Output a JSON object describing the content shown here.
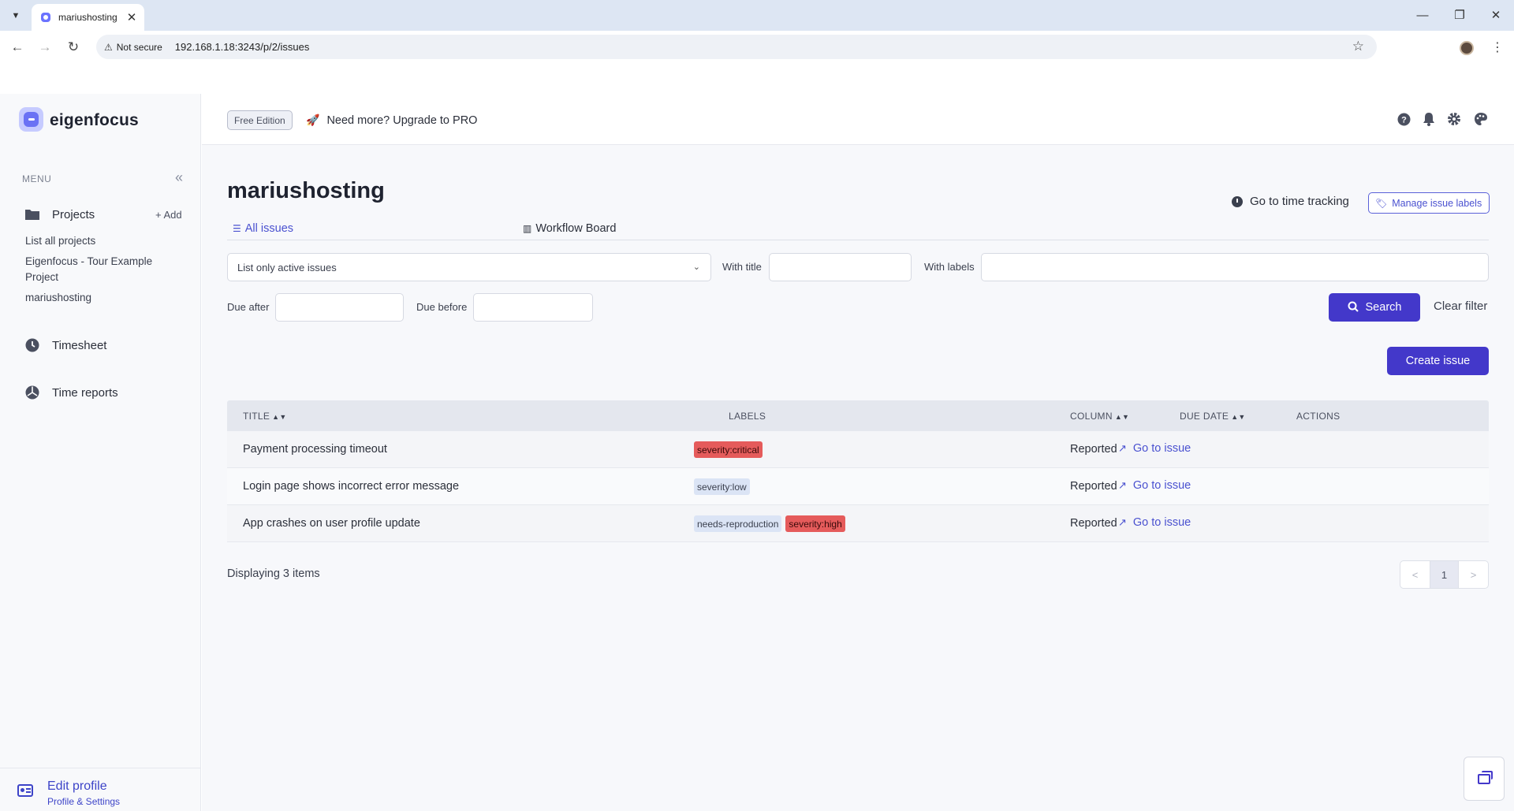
{
  "browser": {
    "tab_title": "mariushosting",
    "not_secure": "Not secure",
    "url": "192.168.1.18:3243/p/2/issues"
  },
  "sidebar": {
    "brand": "eigenfocus",
    "menu_label": "MENU",
    "projects_label": "Projects",
    "add_label": "Add",
    "project_links": [
      "List all projects",
      "Eigenfocus - Tour Example Project",
      "mariushosting"
    ],
    "timesheet_label": "Timesheet",
    "time_reports_label": "Time reports",
    "edit_profile": "Edit profile",
    "profile_settings": "Profile & Settings"
  },
  "topbar": {
    "edition_badge": "Free Edition",
    "upgrade_text": "Need more? Upgrade to PRO"
  },
  "page": {
    "title": "mariushosting",
    "time_tracking_link": "Go to time tracking",
    "manage_labels_button": "Manage issue labels",
    "tabs": {
      "all_issues": "All issues",
      "workflow_board": "Workflow Board"
    }
  },
  "filters": {
    "status_select": "List only active issues",
    "with_title_label": "With title",
    "with_title_value": "",
    "with_labels_label": "With labels",
    "with_labels_value": "",
    "due_after_label": "Due after",
    "due_after_value": "",
    "due_before_label": "Due before",
    "due_before_value": "",
    "search_button": "Search",
    "clear_filter": "Clear filter"
  },
  "create_issue_button": "Create issue",
  "table": {
    "headers": {
      "title": "TITLE",
      "labels": "LABELS",
      "column": "COLUMN",
      "due_date": "DUE DATE",
      "actions": "ACTIONS"
    },
    "rows": [
      {
        "title": "Payment processing timeout",
        "labels": [
          {
            "text": "severity:critical",
            "bg": "#e55b5b",
            "fg": "#3a0a0a"
          }
        ],
        "column": "Reported",
        "due_date": "",
        "action": "Go to issue"
      },
      {
        "title": "Login page shows incorrect error message",
        "labels": [
          {
            "text": "severity:low",
            "bg": "#dbe4f5",
            "fg": "#3a3f4d"
          }
        ],
        "column": "Reported",
        "due_date": "",
        "action": "Go to issue"
      },
      {
        "title": "App crashes on user profile update",
        "labels": [
          {
            "text": "needs-reproduction",
            "bg": "#dbe4f5",
            "fg": "#3a3f4d"
          },
          {
            "text": "severity:high",
            "bg": "#e55b5b",
            "fg": "#3a0a0a"
          }
        ],
        "column": "Reported",
        "due_date": "",
        "action": "Go to issue"
      }
    ]
  },
  "pagination": {
    "summary": "Displaying 3 items",
    "prev": "<",
    "current": "1",
    "next": ">"
  },
  "colors": {
    "accent": "#4338ca",
    "link": "#4a51d0",
    "danger_label": "#e55b5b"
  },
  "icons": {
    "projects": "folder-icon",
    "timesheet": "clock-icon",
    "time_reports": "chart-pie-icon",
    "help": "question-circle-icon",
    "notifications": "bell-icon",
    "settings": "gear-icon",
    "theme": "palette-icon"
  }
}
